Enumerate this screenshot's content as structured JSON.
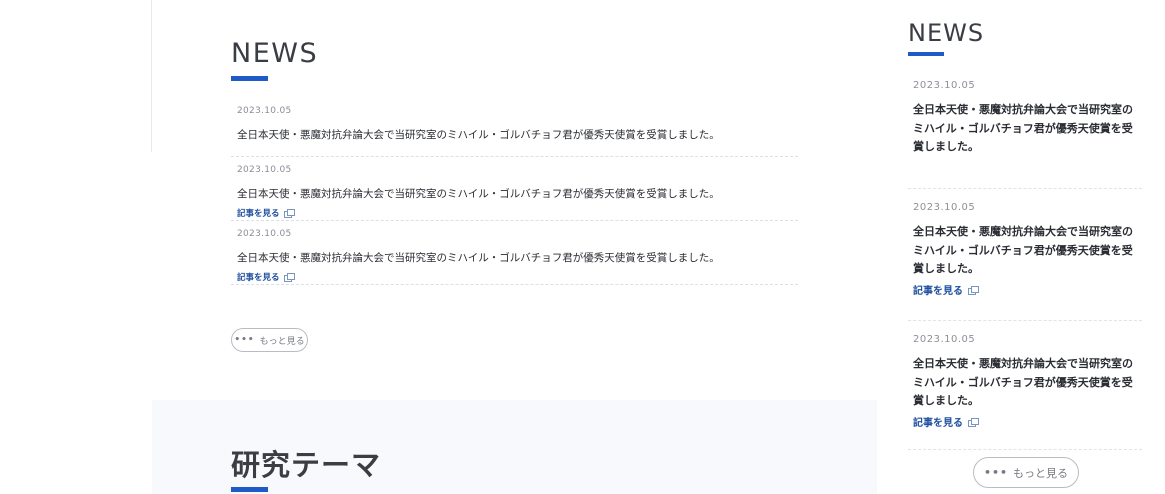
{
  "main_news": {
    "heading": "NEWS",
    "items": [
      {
        "date": "2023.10.05",
        "title": "全日本天使・悪魔対抗弁論大会で当研究室のミハイル・ゴルバチョフ君が優秀天使賞を受賞しました。",
        "link": ""
      },
      {
        "date": "2023.10.05",
        "title": "全日本天使・悪魔対抗弁論大会で当研究室のミハイル・ゴルバチョフ君が優秀天使賞を受賞しました。",
        "link": "記事を見る"
      },
      {
        "date": "2023.10.05",
        "title": "全日本天使・悪魔対抗弁論大会で当研究室のミハイル・ゴルバチョフ君が優秀天使賞を受賞しました。",
        "link": "記事を見る"
      }
    ],
    "more_label": "もっと見る",
    "more_dots": "•••"
  },
  "research": {
    "heading": "研究テーマ"
  },
  "side_news": {
    "heading": "NEWS",
    "items": [
      {
        "date": "2023.10.05",
        "title": "全日本天使・悪魔対抗弁論大会で当研究室のミハイル・ゴルバチョフ君が優秀天使賞を受賞しました。",
        "link": ""
      },
      {
        "date": "2023.10.05",
        "title": "全日本天使・悪魔対抗弁論大会で当研究室のミハイル・ゴルバチョフ君が優秀天使賞を受賞しました。",
        "link": "記事を見る"
      },
      {
        "date": "2023.10.05",
        "title": "全日本天使・悪魔対抗弁論大会で当研究室のミハイル・ゴルバチョフ君が優秀天使賞を受賞しました。",
        "link": "記事を見る"
      }
    ],
    "more_label": "もっと見る",
    "more_dots": "•••"
  },
  "colors": {
    "accent": "#1e5bc6",
    "link": "#1e4f9e",
    "section_bg": "#f7f9fc"
  },
  "icons": {
    "external_link": "external-link-icon",
    "more_dots": "more-dots-icon"
  }
}
